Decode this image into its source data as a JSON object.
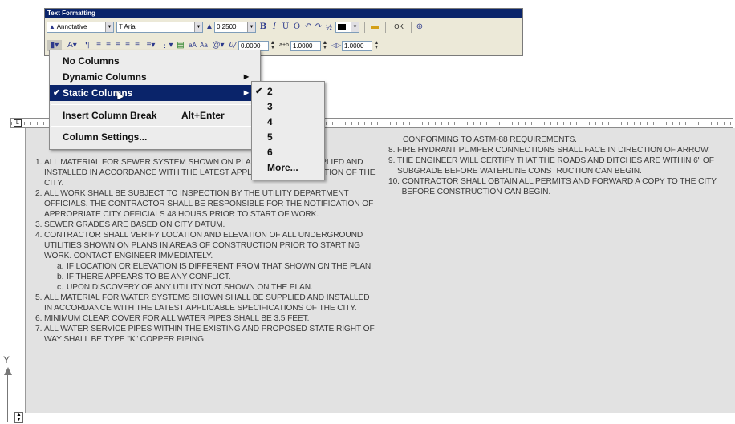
{
  "toolbar": {
    "title": "Text Formatting",
    "style_value": "Annotative",
    "font_value": "Arial",
    "height_value": "0.2500",
    "ok_label": "OK",
    "oblique_value": "0.0000",
    "tracking_value": "1.0000",
    "width_factor_value": "1.0000",
    "tracking_prefix": "a+b"
  },
  "menu": {
    "items": [
      {
        "label": "No Columns"
      },
      {
        "label": "Dynamic Columns"
      },
      {
        "label": "Static Columns"
      },
      {
        "label": "Insert Column Break",
        "shortcut": "Alt+Enter"
      },
      {
        "label": "Column Settings..."
      }
    ]
  },
  "submenu": {
    "items": [
      "2",
      "3",
      "4",
      "5",
      "6",
      "More..."
    ]
  },
  "notes": {
    "left": [
      {
        "num": "1. ",
        "text": "ALL MATERIAL FOR SEWER SYSTEM SHOWN ON PLANS SHALL BE SUPPLIED AND INSTALLED IN ACCORDANCE WITH THE LATEST APPLICABLE SPECIFICATION OF THE CITY."
      },
      {
        "num": "2. ",
        "text": "ALL WORK SHALL BE SUBJECT TO INSPECTION BY THE UTILITY DEPARTMENT OFFICIALS. THE CONTRACTOR SHALL BE RESPONSIBLE FOR THE NOTIFICATION OF APPROPRIATE CITY OFFICIALS 48 HOURS PRIOR TO START OF WORK."
      },
      {
        "num": "3. ",
        "text": "SEWER GRADES ARE BASED ON CITY DATUM."
      },
      {
        "num": "4. ",
        "text": "CONTRACTOR SHALL VERIFY LOCATION AND ELEVATION OF ALL UNDERGROUND UTILITIES SHOWN ON PLANS IN AREAS OF CONSTRUCTION PRIOR TO STARTING WORK. CONTACT ENGINEER IMMEDIATELY."
      }
    ],
    "left_sub": [
      {
        "num": "a.",
        "text": "IF LOCATION OR ELEVATION IS DIFFERENT FROM THAT SHOWN ON THE PLAN."
      },
      {
        "num": "b.",
        "text": "IF THERE APPEARS TO BE ANY CONFLICT."
      },
      {
        "num": "c.",
        "text": "UPON DISCOVERY OF ANY UTILITY NOT SHOWN ON THE PLAN."
      }
    ],
    "left_after": [
      {
        "num": "5. ",
        "text": "ALL MATERIAL FOR WATER SYSTEMS SHOWN SHALL BE SUPPLIED AND INSTALLED IN ACCORDANCE WITH THE LATEST APPLICABLE SPECIFICATIONS OF THE CITY."
      },
      {
        "num": "6. ",
        "text": "MINIMUM CLEAR COVER FOR ALL WATER PIPES SHALL BE 3.5 FEET."
      },
      {
        "num": "7. ",
        "text": "ALL WATER SERVICE PIPES WITHIN THE EXISTING AND PROPOSED STATE RIGHT OF WAY SHALL BE TYPE \"K\" COPPER PIPING"
      }
    ],
    "right_continuation": "CONFORMING TO ASTM-88 REQUIREMENTS.",
    "right": [
      {
        "num": "8. ",
        "text": "FIRE HYDRANT PUMPER CONNECTIONS SHALL FACE IN DIRECTION OF ARROW."
      },
      {
        "num": "9. ",
        "text": "THE ENGINEER WILL CERTIFY THAT THE ROADS AND DITCHES ARE WITHIN 6\" OF SUBGRADE BEFORE WATERLINE CONSTRUCTION CAN BEGIN."
      },
      {
        "num": "10. ",
        "text": "CONTRACTOR SHALL OBTAIN ALL PERMITS AND FORWARD A COPY TO THE CITY BEFORE CONSTRUCTION CAN BEGIN."
      }
    ]
  },
  "ucs": {
    "axis_label": "Y"
  },
  "colors": {
    "selection": "#0a246a",
    "toolbar_bg": "#ece9d8",
    "doc_bg": "#e2e2e2"
  }
}
